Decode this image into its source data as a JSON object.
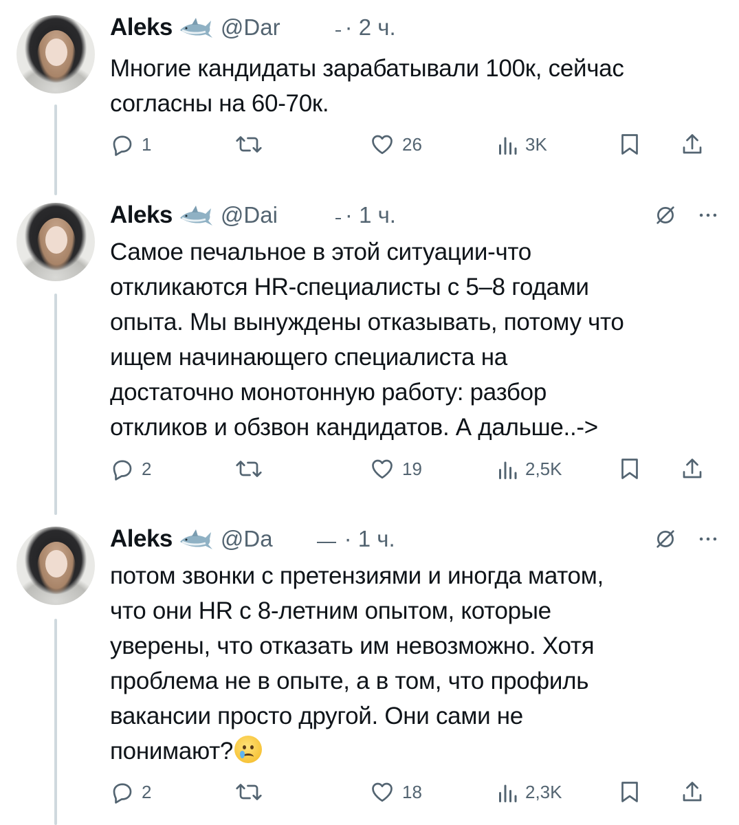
{
  "colors": {
    "text": "#0f1419",
    "muted": "#536471",
    "thread_line": "#cfd9de",
    "background": "#ffffff"
  },
  "tweets": [
    {
      "name": "Aleks",
      "handle": "@Dar",
      "time": "· 2 ч.",
      "text_lines": [
        "Многие кандидаты зарабатывали 100к, сейчас",
        "согласны на 60-70к."
      ],
      "emoji": "",
      "replies": "1",
      "likes": "26",
      "views": "3K",
      "has_header_icons": false
    },
    {
      "name": "Aleks",
      "handle": "@Dai",
      "time": "· 1 ч.",
      "text_lines": [
        "Самое печальное в этой ситуации-что",
        "откликаются HR-специалисты с 5–8 годами",
        "опыта. Мы вынуждены отказывать, потому что",
        "ищем начинающего специалиста на",
        "достаточно монотонную работу: разбор",
        "откликов и обзвон кандидатов. А дальше..->"
      ],
      "emoji": "",
      "replies": "2",
      "likes": "19",
      "views": "2,5K",
      "has_header_icons": true
    },
    {
      "name": "Aleks",
      "handle": "@Da",
      "time": "· 1 ч.",
      "text_lines": [
        "потом звонки с претензиями и иногда матом,",
        "что они HR с 8-летним опытом, которые",
        "уверены, что отказать им невозможно. Хотя",
        "проблема не в опыте, а в том, что профиль",
        "вакансии просто другой. Они сами не",
        "понимают?"
      ],
      "emoji": "crying-face-emoji",
      "replies": "2",
      "likes": "18",
      "views": "2,3K",
      "has_header_icons": true
    }
  ]
}
